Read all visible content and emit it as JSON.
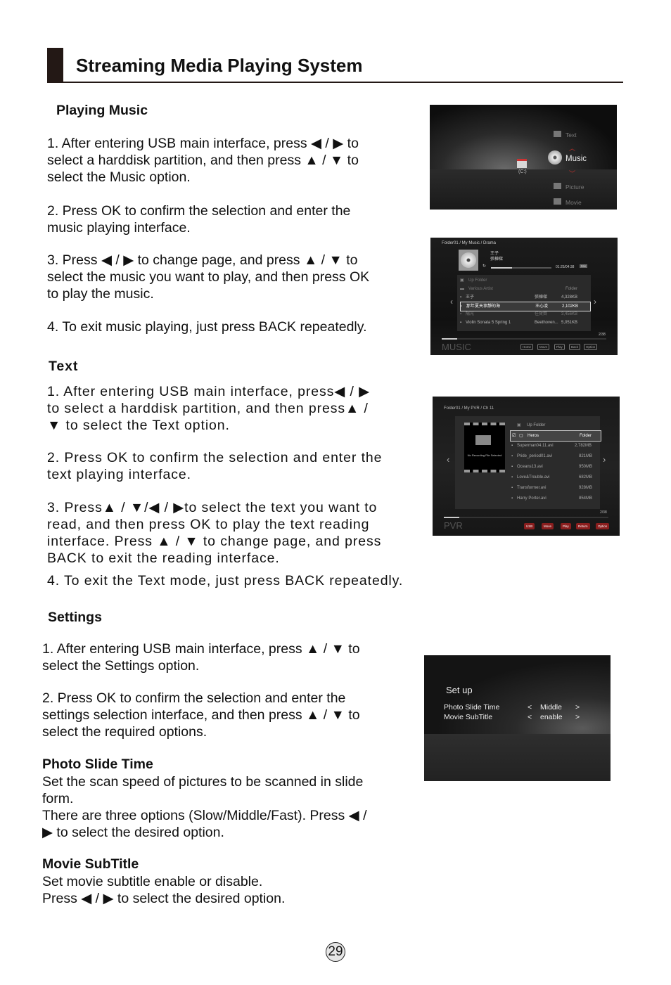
{
  "header": {
    "title": "Streaming Media Playing System"
  },
  "music": {
    "title": "Playing Music",
    "steps": [
      "1. After entering USB main interface, press ◀ / ▶ to\nselect a harddisk partition, and then press ▲ / ▼ to\nselect the Music option.",
      "2. Press OK to confirm the selection and enter the\nmusic playing interface.",
      "3. Press ◀ / ▶ to change page, and press ▲ / ▼ to\nselect the music you want to play, and then press OK\nto play the music.",
      "4. To exit music playing, just press BACK repeatedly."
    ]
  },
  "text": {
    "title": "Text",
    "steps": [
      "1. After entering USB main interface, press◀ / ▶\nto select a harddisk partition, and then press▲ /\n▼ to select the Text option.",
      "2. Press OK to confirm the selection and enter the\ntext playing interface.",
      "3. Press▲ / ▼/◀ / ▶to select the text you want to\nread, and then press OK to play the text reading\ninterface. Press ▲ / ▼ to change page, and press\nBACK to exit the reading interface.",
      "4. To exit the Text mode, just press BACK repeatedly."
    ]
  },
  "settings": {
    "title": "Settings",
    "steps": [
      "1. After entering USB main interface, press ▲ / ▼ to\nselect the Settings option.",
      "2. Press OK to confirm the selection and enter the\nsettings selection interface, and then press ▲ / ▼ to\nselect the required options."
    ],
    "photo_slide": {
      "title": "Photo Slide Time",
      "body": "Set the scan speed of pictures to be scanned in slide\nform.\nThere are three options (Slow/Middle/Fast). Press ◀ /\n▶ to select the desired option."
    },
    "movie_subtitle": {
      "title": "Movie SubTitle",
      "body": "Set movie subtitle enable or disable.\nPress ◀ / ▶ to select the desired option."
    }
  },
  "screen_usb_menu": {
    "drive_label": "(C:)",
    "items": [
      "Text",
      "Music",
      "Picture",
      "Movie"
    ],
    "selected": "Music",
    "up_arrow": "︿",
    "down_arrow": "﹀"
  },
  "screen_music": {
    "breadcrumb": "Folder01 / My Music / Drama",
    "now_playing_title": "王子",
    "now_playing_artist": "張棟樑",
    "progress": 0.35,
    "time": "01:25/04:38",
    "mode_badge": "Mix",
    "rows": [
      {
        "name": "Up Folder",
        "artist": "",
        "size": ""
      },
      {
        "name": "Various Artist",
        "artist": "",
        "size": "Folder"
      },
      {
        "name": "王子",
        "artist": "張棟樑",
        "size": "4,328KB"
      },
      {
        "name": "那年夏天寧靜的海",
        "artist": "王心凌",
        "size": "2,102KB"
      },
      {
        "name": "陽光",
        "artist": "任賢齊",
        "size": "3,456KB"
      },
      {
        "name": "Violin Sonata 5 Spring 1",
        "artist": "Beethoven...",
        "size": "5,051KB"
      }
    ],
    "selected_row": 3,
    "page": "2/38",
    "mode_label": "MUSIC",
    "footer_buttons": [
      "Home",
      "Move",
      "Play",
      "Back",
      "Option"
    ]
  },
  "screen_pvr": {
    "breadcrumb": "Folder01 / My PVR / Ch 11",
    "preview_text": "No Recording File Selected",
    "rows": [
      {
        "name": "Up Folder",
        "size": ""
      },
      {
        "name": "Heros",
        "size": "Folder"
      },
      {
        "name": "Superman04.11.avi",
        "size": "2,782MB"
      },
      {
        "name": "Pride_period01.avi",
        "size": "821MB"
      },
      {
        "name": "Oceans13.avi",
        "size": "950MB"
      },
      {
        "name": "Love&Trouble.avi",
        "size": "682MB"
      },
      {
        "name": "Transformer.avi",
        "size": "928MB"
      },
      {
        "name": "Harry Porter.avi",
        "size": "854MB"
      }
    ],
    "selected_row": 1,
    "page": "2/38",
    "mode_label": "PVR",
    "footer_buttons": [
      "USB",
      "Move",
      "Play",
      "Return",
      "Option"
    ]
  },
  "screen_setup": {
    "title": "Set up",
    "rows": [
      {
        "label": "Photo Slide Time",
        "value": "Middle"
      },
      {
        "label": "Movie SubTitle",
        "value": "enable"
      }
    ],
    "left": "<",
    "right": ">"
  },
  "page_number": "29"
}
